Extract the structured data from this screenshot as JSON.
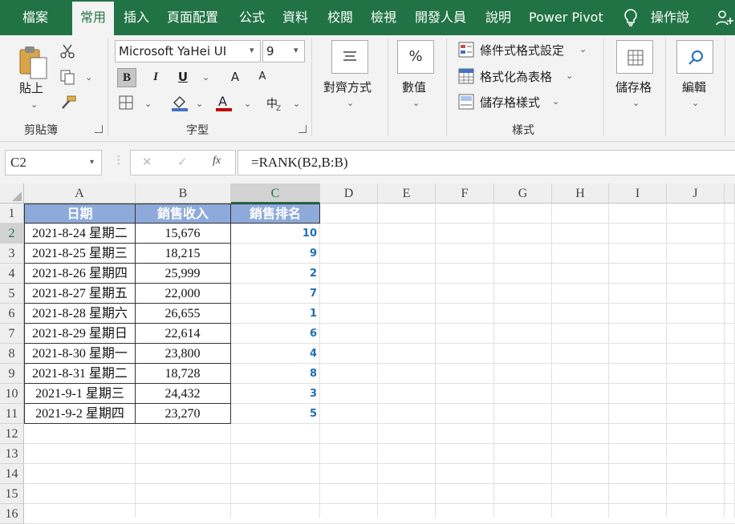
{
  "tabs": [
    "檔案",
    "常用",
    "插入",
    "頁面配置",
    "公式",
    "資料",
    "校閱",
    "檢視",
    "開發人員",
    "說明",
    "Power Pivot",
    "操作說"
  ],
  "ribbon": {
    "clipboard": {
      "paste": "貼上",
      "label": "剪貼簿"
    },
    "font": {
      "name": "Microsoft YaHei UI",
      "size": "9",
      "bold": "B",
      "italic": "I",
      "underline": "U",
      "grow": "A",
      "shrink": "A",
      "label": "字型"
    },
    "alignment": {
      "label": "對齊方式"
    },
    "number": {
      "label": "數值",
      "symbol": "%"
    },
    "styles": {
      "conditional": "條件式格式設定",
      "as_table": "格式化為表格",
      "cell_styles": "儲存格樣式",
      "label": "樣式"
    },
    "cells": {
      "label": "儲存格"
    },
    "editing": {
      "label": "編輯"
    }
  },
  "formula_bar": {
    "name_box": "C2",
    "fx": "fx",
    "formula": "=RANK(B2,B:B)"
  },
  "columns": [
    "A",
    "B",
    "C",
    "D",
    "E",
    "F",
    "G",
    "H",
    "I",
    "J"
  ],
  "rows": [
    "1",
    "2",
    "3",
    "4",
    "5",
    "6",
    "7",
    "8",
    "9",
    "10",
    "11",
    "12",
    "13",
    "14",
    "15",
    "16"
  ],
  "table": {
    "headers": [
      "日期",
      "銷售收入",
      "銷售排名"
    ],
    "rows": [
      {
        "date": "2021-8-24 星期二",
        "sales": "15,676",
        "rank": "10"
      },
      {
        "date": "2021-8-25 星期三",
        "sales": "18,215",
        "rank": "9"
      },
      {
        "date": "2021-8-26 星期四",
        "sales": "25,999",
        "rank": "2"
      },
      {
        "date": "2021-8-27 星期五",
        "sales": "22,000",
        "rank": "7"
      },
      {
        "date": "2021-8-28 星期六",
        "sales": "26,655",
        "rank": "1"
      },
      {
        "date": "2021-8-29 星期日",
        "sales": "22,614",
        "rank": "6"
      },
      {
        "date": "2021-8-30 星期一",
        "sales": "23,800",
        "rank": "4"
      },
      {
        "date": "2021-8-31 星期二",
        "sales": "18,728",
        "rank": "8"
      },
      {
        "date": "2021-9-1 星期三",
        "sales": "24,432",
        "rank": "3"
      },
      {
        "date": "2021-9-2 星期四",
        "sales": "23,270",
        "rank": "5"
      }
    ]
  },
  "colors": {
    "accent": "#217346",
    "header_fill": "#8eaadb",
    "rank_text": "#1f6eb5"
  }
}
